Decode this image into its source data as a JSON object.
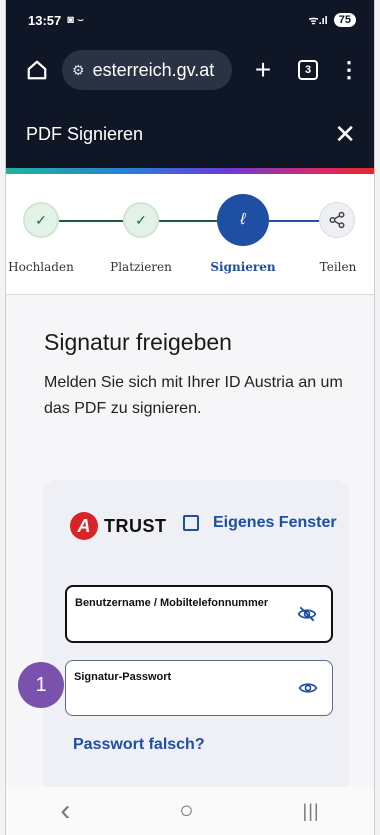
{
  "status": {
    "time": "13:57",
    "icons": "◙ ⌣",
    "right_icons": "ᯤ.ıl",
    "battery": "75"
  },
  "browser": {
    "url": "esterreich.gv.at",
    "tab_count": "3",
    "home_icon": "home-icon",
    "plus": "+",
    "menu": "⋮"
  },
  "title_bar": {
    "title": "PDF Signieren",
    "close": "✕"
  },
  "stepper": {
    "steps": [
      {
        "label": "Hochladen",
        "state": "done",
        "glyph": "✓"
      },
      {
        "label": "Platzieren",
        "state": "done",
        "glyph": "✓"
      },
      {
        "label": "Signieren",
        "state": "active",
        "glyph": "ℓ"
      },
      {
        "label": "Teilen",
        "state": "todo",
        "glyph": "⋖"
      }
    ]
  },
  "main": {
    "heading": "Signatur freigeben",
    "description": "Melden Sie sich mit Ihrer ID Austria an um das PDF zu signieren."
  },
  "login_card": {
    "brand": "TRUST",
    "logo_letter": "A",
    "external_link": "Eigenes Fenster",
    "username_label": "Benutzername / Mobiltelefonnummer",
    "password_label": "Signatur-Passwort",
    "forgot_link": "Passwort falsch?"
  },
  "annotation": {
    "badge": "1"
  },
  "nav": {
    "back": "‹",
    "home": "○",
    "recents": "|||"
  },
  "colors": {
    "dark": "#0f1726",
    "accent": "#1f4fa3",
    "badge": "#7a52ad",
    "done": "#e3f2e6"
  }
}
